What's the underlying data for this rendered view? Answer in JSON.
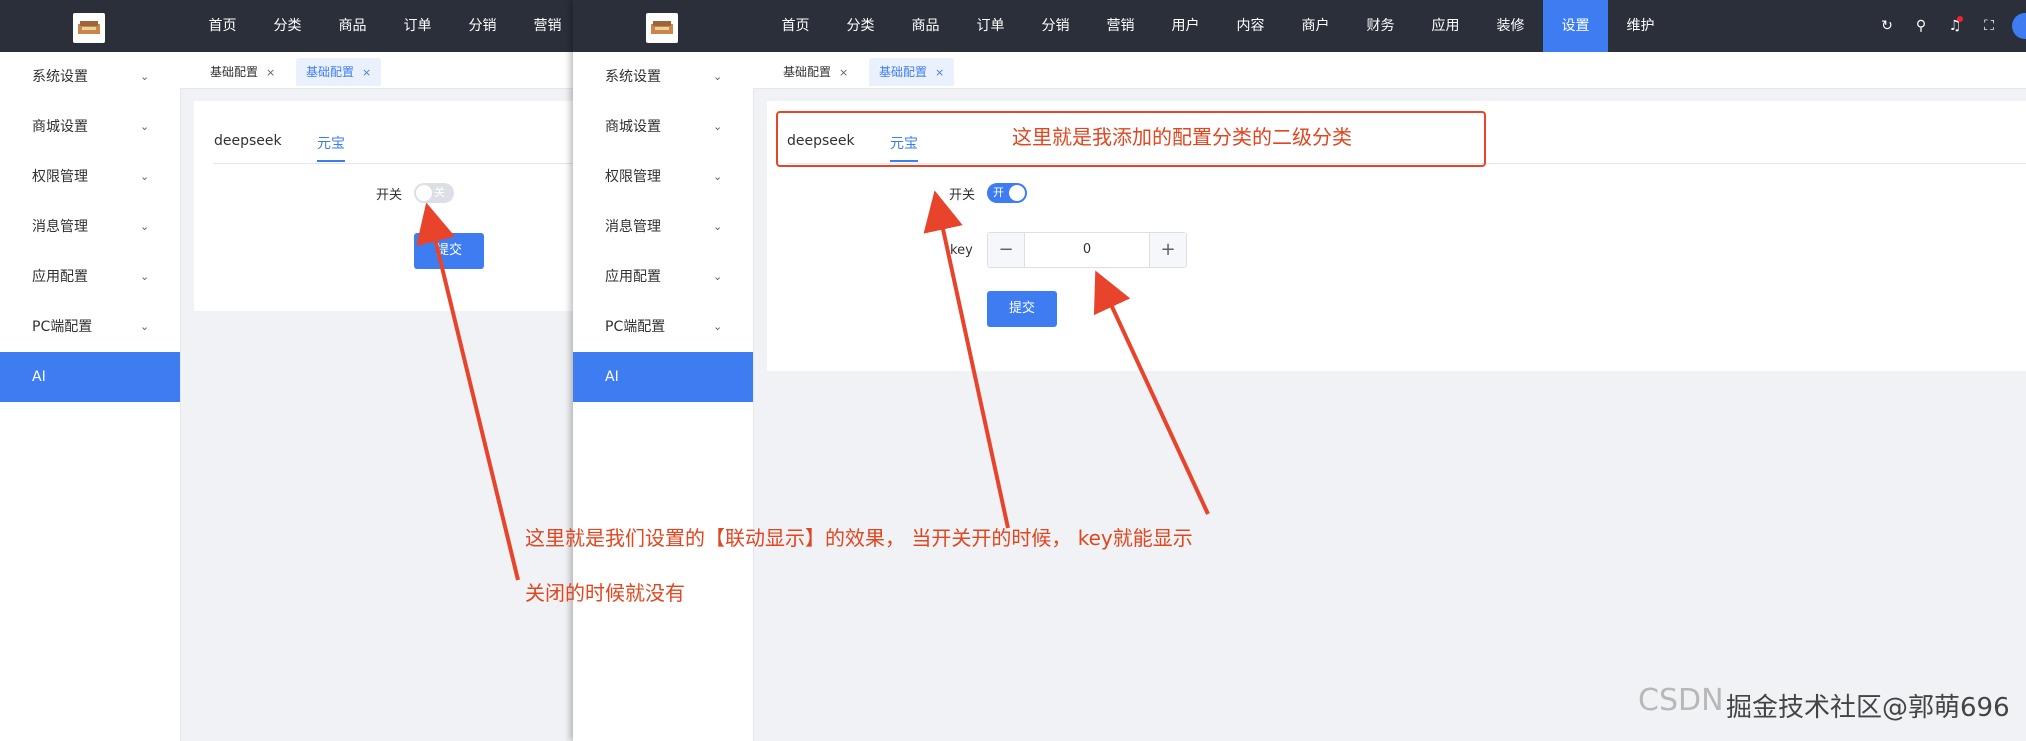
{
  "left_panel": {
    "nav": [
      "首页",
      "分类",
      "商品",
      "订单",
      "分销",
      "营销"
    ],
    "sidebar": [
      {
        "label": "系统设置",
        "chevron": "chevron-down-icon"
      },
      {
        "label": "商城设置",
        "chevron": "chevron-down-icon"
      },
      {
        "label": "权限管理",
        "chevron": "chevron-down-icon"
      },
      {
        "label": "消息管理",
        "chevron": "chevron-down-icon"
      },
      {
        "label": "应用配置",
        "chevron": "chevron-down-icon"
      },
      {
        "label": "PC端配置",
        "chevron": "chevron-down-icon"
      },
      {
        "label": "AI",
        "active": true
      }
    ],
    "tabs": [
      {
        "label": "基础配置",
        "close": "×"
      },
      {
        "label": "基础配置",
        "close": "×",
        "active": true
      }
    ],
    "subtabs": [
      "deepseek",
      "元宝"
    ],
    "form": {
      "switch_label": "开关",
      "switch_text": "关",
      "switch_state": "off",
      "submit": "提交"
    }
  },
  "right_panel": {
    "nav": [
      "首页",
      "分类",
      "商品",
      "订单",
      "分销",
      "营销",
      "用户",
      "内容",
      "商户",
      "财务",
      "应用",
      "装修",
      "设置",
      "维护"
    ],
    "active_nav": "设置",
    "top_icons": [
      "refresh-icon",
      "search-icon",
      "bell-icon",
      "fullscreen-icon"
    ],
    "sidebar": [
      {
        "label": "系统设置",
        "chevron": "chevron-down-icon"
      },
      {
        "label": "商城设置",
        "chevron": "chevron-down-icon"
      },
      {
        "label": "权限管理",
        "chevron": "chevron-down-icon"
      },
      {
        "label": "消息管理",
        "chevron": "chevron-down-icon"
      },
      {
        "label": "应用配置",
        "chevron": "chevron-down-icon"
      },
      {
        "label": "PC端配置",
        "chevron": "chevron-down-icon"
      },
      {
        "label": "AI",
        "active": true
      }
    ],
    "tabs": [
      {
        "label": "基础配置",
        "close": "×"
      },
      {
        "label": "基础配置",
        "close": "×",
        "active": true
      }
    ],
    "subtabs": [
      "deepseek",
      "元宝"
    ],
    "form": {
      "switch_label": "开关",
      "switch_text": "开",
      "switch_state": "on",
      "key_label": "key",
      "key_value": "0",
      "minus": "−",
      "plus": "+",
      "submit": "提交"
    }
  },
  "annotations": {
    "box_text": "这里就是我添加的配置分类的二级分类",
    "line1": "这里就是我们设置的【联动显示】的效果，  当开关开的时候，  key就能显示",
    "line2": "关闭的时候就没有"
  },
  "watermark": {
    "back": "CSDN",
    "front": "掘金技术社区@郭萌696"
  },
  "colors": {
    "accent": "#3e7df1",
    "topbar": "#2b2f3a",
    "annotation": "#e0461f"
  }
}
